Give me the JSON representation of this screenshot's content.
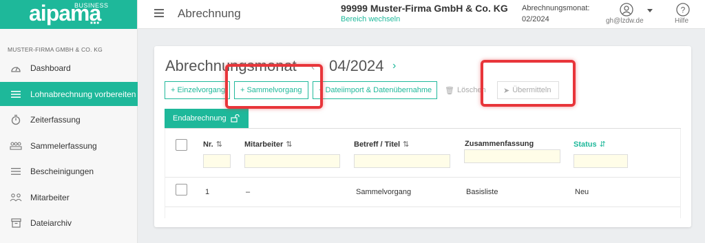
{
  "logo": {
    "brand": "aipama",
    "tag": "BUSINESS",
    "dots": "■■■"
  },
  "sidebar": {
    "company": "MUSTER-FIRMA GMBH & CO. KG",
    "items": [
      {
        "label": "Dashboard",
        "icon": "gauge-icon"
      },
      {
        "label": "Lohnabrechnung vorbereiten",
        "icon": "list-icon",
        "active": true
      },
      {
        "label": "Zeiterfassung",
        "icon": "stopwatch-icon"
      },
      {
        "label": "Sammelerfassung",
        "icon": "group-icon"
      },
      {
        "label": "Bescheinigungen",
        "icon": "list-icon"
      },
      {
        "label": "Mitarbeiter",
        "icon": "people-icon"
      },
      {
        "label": "Dateiarchiv",
        "icon": "archive-icon"
      }
    ]
  },
  "header": {
    "title": "Abrechnung",
    "firm": "99999 Muster-Firma GmbH & Co. KG",
    "switch_area": "Bereich wechseln",
    "month_label": "Abrechnungsmonat:",
    "month_value": "02/2024",
    "user_email": "gh@lzdw.de",
    "help": "Hilfe"
  },
  "main": {
    "title": "Abrechnungsmonat",
    "month": "04/2024",
    "buttons": {
      "einzel": "Einzelvorgang",
      "sammel": "Sammelvorgang",
      "import": "Dateiimport & Datenübernahme",
      "delete": "Löschen",
      "submit": "Übermitteln"
    },
    "tab": "Endabrechnung",
    "columns": {
      "nr": "Nr.",
      "mitarbeiter": "Mitarbeiter",
      "betreff": "Betreff / Titel",
      "zusammenfassung": "Zusammenfassung",
      "status": "Status"
    },
    "rows": [
      {
        "nr": "1",
        "mitarbeiter": "–",
        "betreff": "Sammelvorgang",
        "zusammenfassung": "Basisliste",
        "status": "Neu"
      }
    ]
  },
  "colors": {
    "accent": "#1eb89a",
    "highlight": "#e8353a"
  }
}
